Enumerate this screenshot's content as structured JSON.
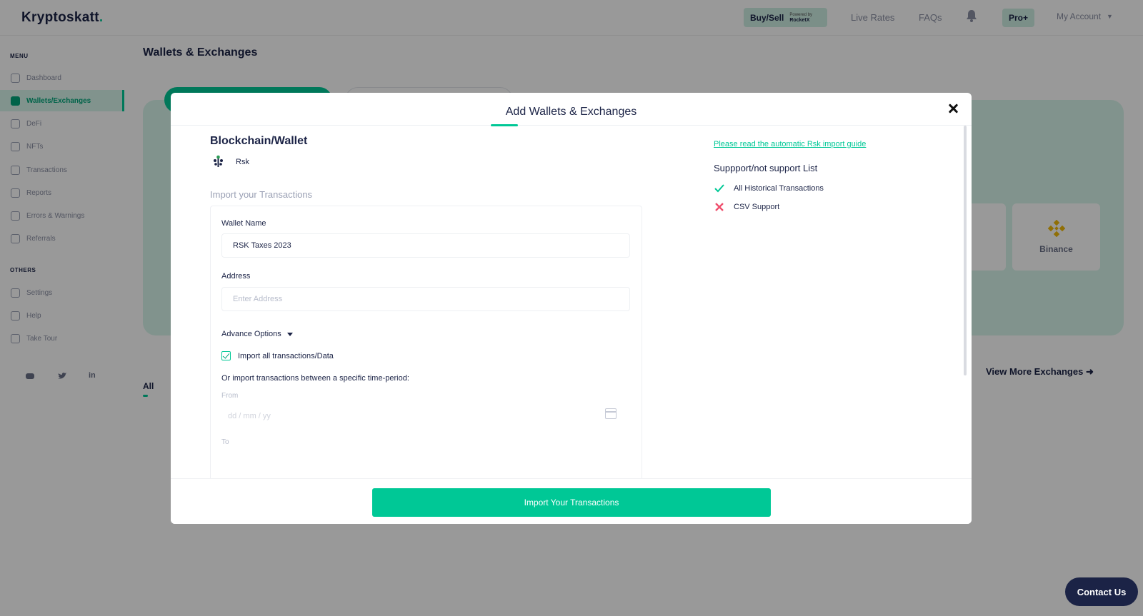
{
  "app": {
    "logo": "Kryptoskatt",
    "logo_dot": "."
  },
  "topbar": {
    "buy_sell": "Buy/Sell",
    "powered_by": "Powered by",
    "powered_brand": "RocketX",
    "nav": [
      "Live Rates",
      "FAQs"
    ],
    "pro": "Pro+",
    "account": "My Account"
  },
  "sidebar": {
    "menu_heading": "MENU",
    "items": [
      {
        "label": "Dashboard",
        "icon": "dashboard-icon"
      },
      {
        "label": "Wallets/Exchanges",
        "icon": "wallet-icon",
        "active": true
      },
      {
        "label": "DeFi",
        "icon": "defi-icon"
      },
      {
        "label": "NFTs",
        "icon": "nft-icon"
      },
      {
        "label": "Transactions",
        "icon": "transactions-icon"
      },
      {
        "label": "Reports",
        "icon": "reports-icon"
      },
      {
        "label": "Errors & Warnings",
        "icon": "warning-icon"
      },
      {
        "label": "Referrals",
        "icon": "referrals-icon"
      }
    ],
    "others_heading": "OTHERS",
    "others": [
      {
        "label": "Settings",
        "icon": "gear-icon"
      },
      {
        "label": "Help",
        "icon": "help-icon"
      },
      {
        "label": "Take Tour",
        "icon": "tour-icon"
      }
    ],
    "social": [
      "discord-icon",
      "twitter-icon",
      "linkedin-icon"
    ],
    "social_labels": {
      "linkedin": "in"
    }
  },
  "page": {
    "title": "Wallets & Exchanges",
    "binance": "Binance",
    "view_more": "View More Exchanges",
    "all_tab": "All",
    "contact": "Contact Us"
  },
  "modal": {
    "title": "Add Wallets & Exchanges",
    "section_title": "Blockchain/Wallet",
    "chain": "Rsk",
    "import_heading": "Import your Transactions",
    "wallet_name_label": "Wallet Name",
    "wallet_name_value": "RSK Taxes 2023",
    "address_label": "Address",
    "address_placeholder": "Enter Address",
    "advance_options": "Advance Options",
    "import_all": "Import all transactions/Data",
    "import_all_checked": true,
    "period_text": "Or import transactions between a specific time-period:",
    "from_label": "From",
    "date_placeholder": "dd / mm / yy",
    "to_label": "To",
    "guide_link": "Please read the automatic Rsk import guide",
    "support_title": "Suppport/not support List",
    "support": [
      {
        "label": "All Historical Transactions",
        "supported": true
      },
      {
        "label": "CSV Support",
        "supported": false
      }
    ],
    "import_button": "Import Your Transactions"
  },
  "colors": {
    "accent": "#00c896",
    "navy": "#1b2346",
    "error": "#f0506e"
  }
}
